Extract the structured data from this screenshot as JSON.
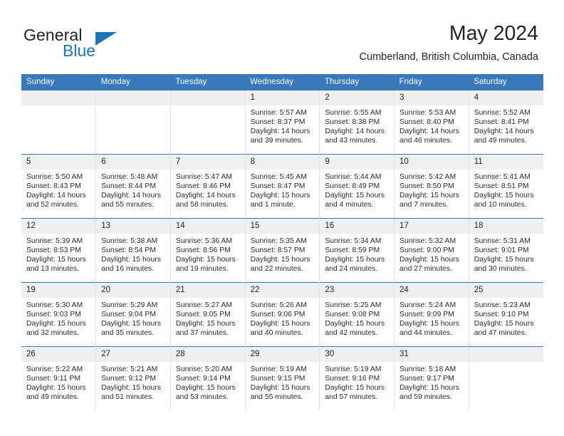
{
  "brand": {
    "name_part1": "General",
    "name_part2": "Blue",
    "accent_color": "#1b75bb",
    "triangle_icon": "triangle-icon"
  },
  "header": {
    "month_title": "May 2024",
    "location": "Cumberland, British Columbia, Canada"
  },
  "calendar": {
    "header_bg_color": "#3879bb",
    "daynum_bg_color": "#f0f0f0",
    "weekday_headers": [
      "Sunday",
      "Monday",
      "Tuesday",
      "Wednesday",
      "Thursday",
      "Friday",
      "Saturday"
    ],
    "weeks": [
      [
        {
          "day": "",
          "empty": true,
          "sunrise": "",
          "sunset": "",
          "daylight": ""
        },
        {
          "day": "",
          "empty": true,
          "sunrise": "",
          "sunset": "",
          "daylight": ""
        },
        {
          "day": "",
          "empty": true,
          "sunrise": "",
          "sunset": "",
          "daylight": ""
        },
        {
          "day": "1",
          "empty": false,
          "sunrise": "Sunrise: 5:57 AM",
          "sunset": "Sunset: 8:37 PM",
          "daylight": "Daylight: 14 hours and 39 minutes."
        },
        {
          "day": "2",
          "empty": false,
          "sunrise": "Sunrise: 5:55 AM",
          "sunset": "Sunset: 8:38 PM",
          "daylight": "Daylight: 14 hours and 43 minutes."
        },
        {
          "day": "3",
          "empty": false,
          "sunrise": "Sunrise: 5:53 AM",
          "sunset": "Sunset: 8:40 PM",
          "daylight": "Daylight: 14 hours and 46 minutes."
        },
        {
          "day": "4",
          "empty": false,
          "sunrise": "Sunrise: 5:52 AM",
          "sunset": "Sunset: 8:41 PM",
          "daylight": "Daylight: 14 hours and 49 minutes."
        }
      ],
      [
        {
          "day": "5",
          "empty": false,
          "sunrise": "Sunrise: 5:50 AM",
          "sunset": "Sunset: 8:43 PM",
          "daylight": "Daylight: 14 hours and 52 minutes."
        },
        {
          "day": "6",
          "empty": false,
          "sunrise": "Sunrise: 5:48 AM",
          "sunset": "Sunset: 8:44 PM",
          "daylight": "Daylight: 14 hours and 55 minutes."
        },
        {
          "day": "7",
          "empty": false,
          "sunrise": "Sunrise: 5:47 AM",
          "sunset": "Sunset: 8:46 PM",
          "daylight": "Daylight: 14 hours and 58 minutes."
        },
        {
          "day": "8",
          "empty": false,
          "sunrise": "Sunrise: 5:45 AM",
          "sunset": "Sunset: 8:47 PM",
          "daylight": "Daylight: 15 hours and 1 minute."
        },
        {
          "day": "9",
          "empty": false,
          "sunrise": "Sunrise: 5:44 AM",
          "sunset": "Sunset: 8:49 PM",
          "daylight": "Daylight: 15 hours and 4 minutes."
        },
        {
          "day": "10",
          "empty": false,
          "sunrise": "Sunrise: 5:42 AM",
          "sunset": "Sunset: 8:50 PM",
          "daylight": "Daylight: 15 hours and 7 minutes."
        },
        {
          "day": "11",
          "empty": false,
          "sunrise": "Sunrise: 5:41 AM",
          "sunset": "Sunset: 8:51 PM",
          "daylight": "Daylight: 15 hours and 10 minutes."
        }
      ],
      [
        {
          "day": "12",
          "empty": false,
          "sunrise": "Sunrise: 5:39 AM",
          "sunset": "Sunset: 8:53 PM",
          "daylight": "Daylight: 15 hours and 13 minutes."
        },
        {
          "day": "13",
          "empty": false,
          "sunrise": "Sunrise: 5:38 AM",
          "sunset": "Sunset: 8:54 PM",
          "daylight": "Daylight: 15 hours and 16 minutes."
        },
        {
          "day": "14",
          "empty": false,
          "sunrise": "Sunrise: 5:36 AM",
          "sunset": "Sunset: 8:56 PM",
          "daylight": "Daylight: 15 hours and 19 minutes."
        },
        {
          "day": "15",
          "empty": false,
          "sunrise": "Sunrise: 5:35 AM",
          "sunset": "Sunset: 8:57 PM",
          "daylight": "Daylight: 15 hours and 22 minutes."
        },
        {
          "day": "16",
          "empty": false,
          "sunrise": "Sunrise: 5:34 AM",
          "sunset": "Sunset: 8:59 PM",
          "daylight": "Daylight: 15 hours and 24 minutes."
        },
        {
          "day": "17",
          "empty": false,
          "sunrise": "Sunrise: 5:32 AM",
          "sunset": "Sunset: 9:00 PM",
          "daylight": "Daylight: 15 hours and 27 minutes."
        },
        {
          "day": "18",
          "empty": false,
          "sunrise": "Sunrise: 5:31 AM",
          "sunset": "Sunset: 9:01 PM",
          "daylight": "Daylight: 15 hours and 30 minutes."
        }
      ],
      [
        {
          "day": "19",
          "empty": false,
          "sunrise": "Sunrise: 5:30 AM",
          "sunset": "Sunset: 9:03 PM",
          "daylight": "Daylight: 15 hours and 32 minutes."
        },
        {
          "day": "20",
          "empty": false,
          "sunrise": "Sunrise: 5:29 AM",
          "sunset": "Sunset: 9:04 PM",
          "daylight": "Daylight: 15 hours and 35 minutes."
        },
        {
          "day": "21",
          "empty": false,
          "sunrise": "Sunrise: 5:27 AM",
          "sunset": "Sunset: 9:05 PM",
          "daylight": "Daylight: 15 hours and 37 minutes."
        },
        {
          "day": "22",
          "empty": false,
          "sunrise": "Sunrise: 5:26 AM",
          "sunset": "Sunset: 9:06 PM",
          "daylight": "Daylight: 15 hours and 40 minutes."
        },
        {
          "day": "23",
          "empty": false,
          "sunrise": "Sunrise: 5:25 AM",
          "sunset": "Sunset: 9:08 PM",
          "daylight": "Daylight: 15 hours and 42 minutes."
        },
        {
          "day": "24",
          "empty": false,
          "sunrise": "Sunrise: 5:24 AM",
          "sunset": "Sunset: 9:09 PM",
          "daylight": "Daylight: 15 hours and 44 minutes."
        },
        {
          "day": "25",
          "empty": false,
          "sunrise": "Sunrise: 5:23 AM",
          "sunset": "Sunset: 9:10 PM",
          "daylight": "Daylight: 15 hours and 47 minutes."
        }
      ],
      [
        {
          "day": "26",
          "empty": false,
          "sunrise": "Sunrise: 5:22 AM",
          "sunset": "Sunset: 9:11 PM",
          "daylight": "Daylight: 15 hours and 49 minutes."
        },
        {
          "day": "27",
          "empty": false,
          "sunrise": "Sunrise: 5:21 AM",
          "sunset": "Sunset: 9:12 PM",
          "daylight": "Daylight: 15 hours and 51 minutes."
        },
        {
          "day": "28",
          "empty": false,
          "sunrise": "Sunrise: 5:20 AM",
          "sunset": "Sunset: 9:14 PM",
          "daylight": "Daylight: 15 hours and 53 minutes."
        },
        {
          "day": "29",
          "empty": false,
          "sunrise": "Sunrise: 5:19 AM",
          "sunset": "Sunset: 9:15 PM",
          "daylight": "Daylight: 15 hours and 55 minutes."
        },
        {
          "day": "30",
          "empty": false,
          "sunrise": "Sunrise: 5:19 AM",
          "sunset": "Sunset: 9:16 PM",
          "daylight": "Daylight: 15 hours and 57 minutes."
        },
        {
          "day": "31",
          "empty": false,
          "sunrise": "Sunrise: 5:18 AM",
          "sunset": "Sunset: 9:17 PM",
          "daylight": "Daylight: 15 hours and 59 minutes."
        },
        {
          "day": "",
          "empty": true,
          "sunrise": "",
          "sunset": "",
          "daylight": ""
        }
      ]
    ]
  }
}
